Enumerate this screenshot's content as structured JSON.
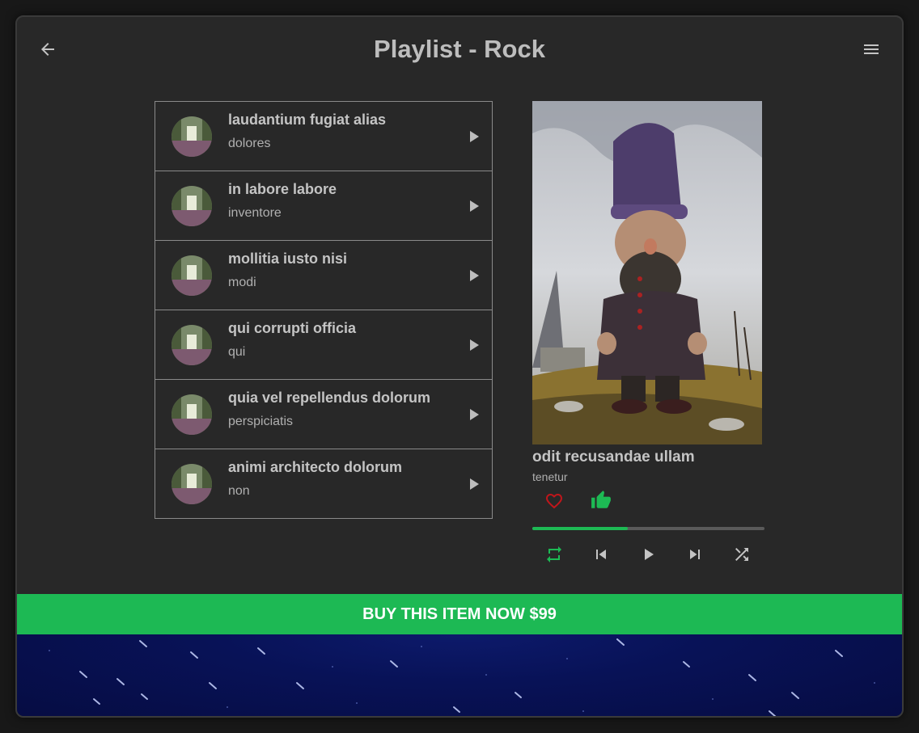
{
  "header": {
    "title": "Playlist - Rock",
    "back_icon": "arrow-left-icon",
    "menu_icon": "hamburger-menu-icon"
  },
  "playlist": {
    "tracks": [
      {
        "title": "laudantium fugiat alias",
        "artist": "dolores"
      },
      {
        "title": "in labore labore",
        "artist": "inventore"
      },
      {
        "title": "mollitia iusto nisi",
        "artist": "modi"
      },
      {
        "title": "qui corrupti officia",
        "artist": "qui"
      },
      {
        "title": "quia vel repellendus dolorum",
        "artist": "perspiciatis"
      },
      {
        "title": "animi architecto dolorum",
        "artist": "non"
      }
    ]
  },
  "now_playing": {
    "title": "odit recusandae ullam",
    "artist": "tenetur",
    "progress_fraction": 0.41,
    "liked": false,
    "thumbs_up": true
  },
  "buy_bar": {
    "label": "BUY THIS ITEM NOW $99"
  },
  "colors": {
    "accent": "#1db954",
    "heart": "#c0161b",
    "background": "#282828"
  }
}
